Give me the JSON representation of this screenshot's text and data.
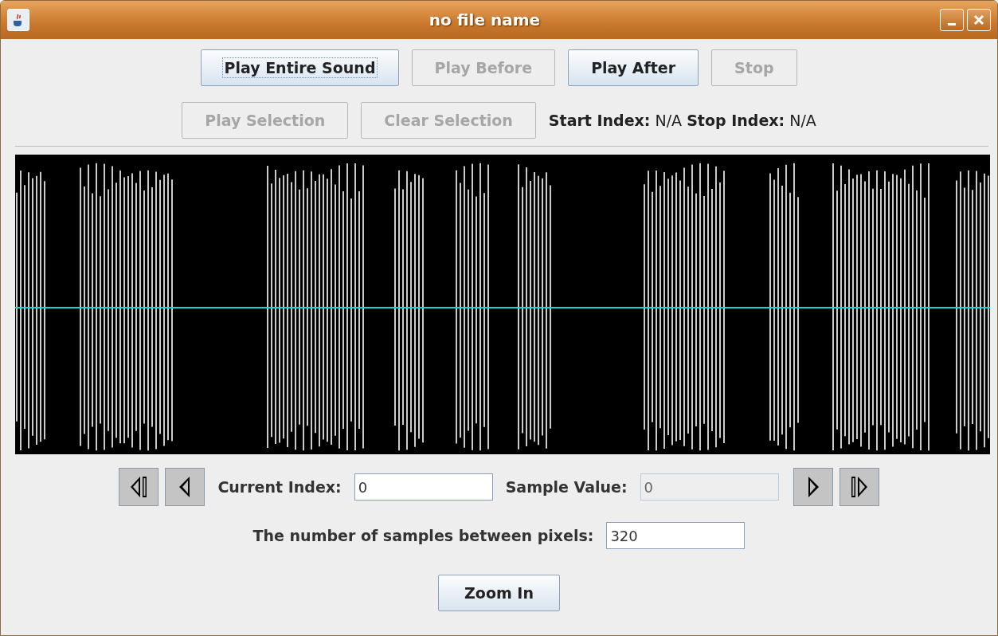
{
  "window": {
    "title": "no file name"
  },
  "play_buttons": [
    {
      "label": "Play Entire Sound",
      "disabled": false,
      "focused": true
    },
    {
      "label": "Play Before",
      "disabled": true,
      "focused": false
    },
    {
      "label": "Play After",
      "disabled": false,
      "focused": false
    },
    {
      "label": "Stop",
      "disabled": true,
      "focused": false
    }
  ],
  "selection_buttons": [
    {
      "label": "Play Selection",
      "disabled": true,
      "focused": false
    },
    {
      "label": "Clear Selection",
      "disabled": true,
      "focused": false
    }
  ],
  "selection_info": "**Start Index:** N/A **Stop Index:** N/A",
  "current_index": {
    "label": "Current Index:",
    "value": "0",
    "disabled": false
  },
  "sample_value": {
    "label": "Sample Value:",
    "value": "0",
    "disabled": true
  },
  "samples_between_pixels": {
    "label": "The number of samples between pixels:",
    "value": "320",
    "disabled": false
  },
  "zoom_button": {
    "label": "Zoom In",
    "disabled": false,
    "focused": false
  }
}
